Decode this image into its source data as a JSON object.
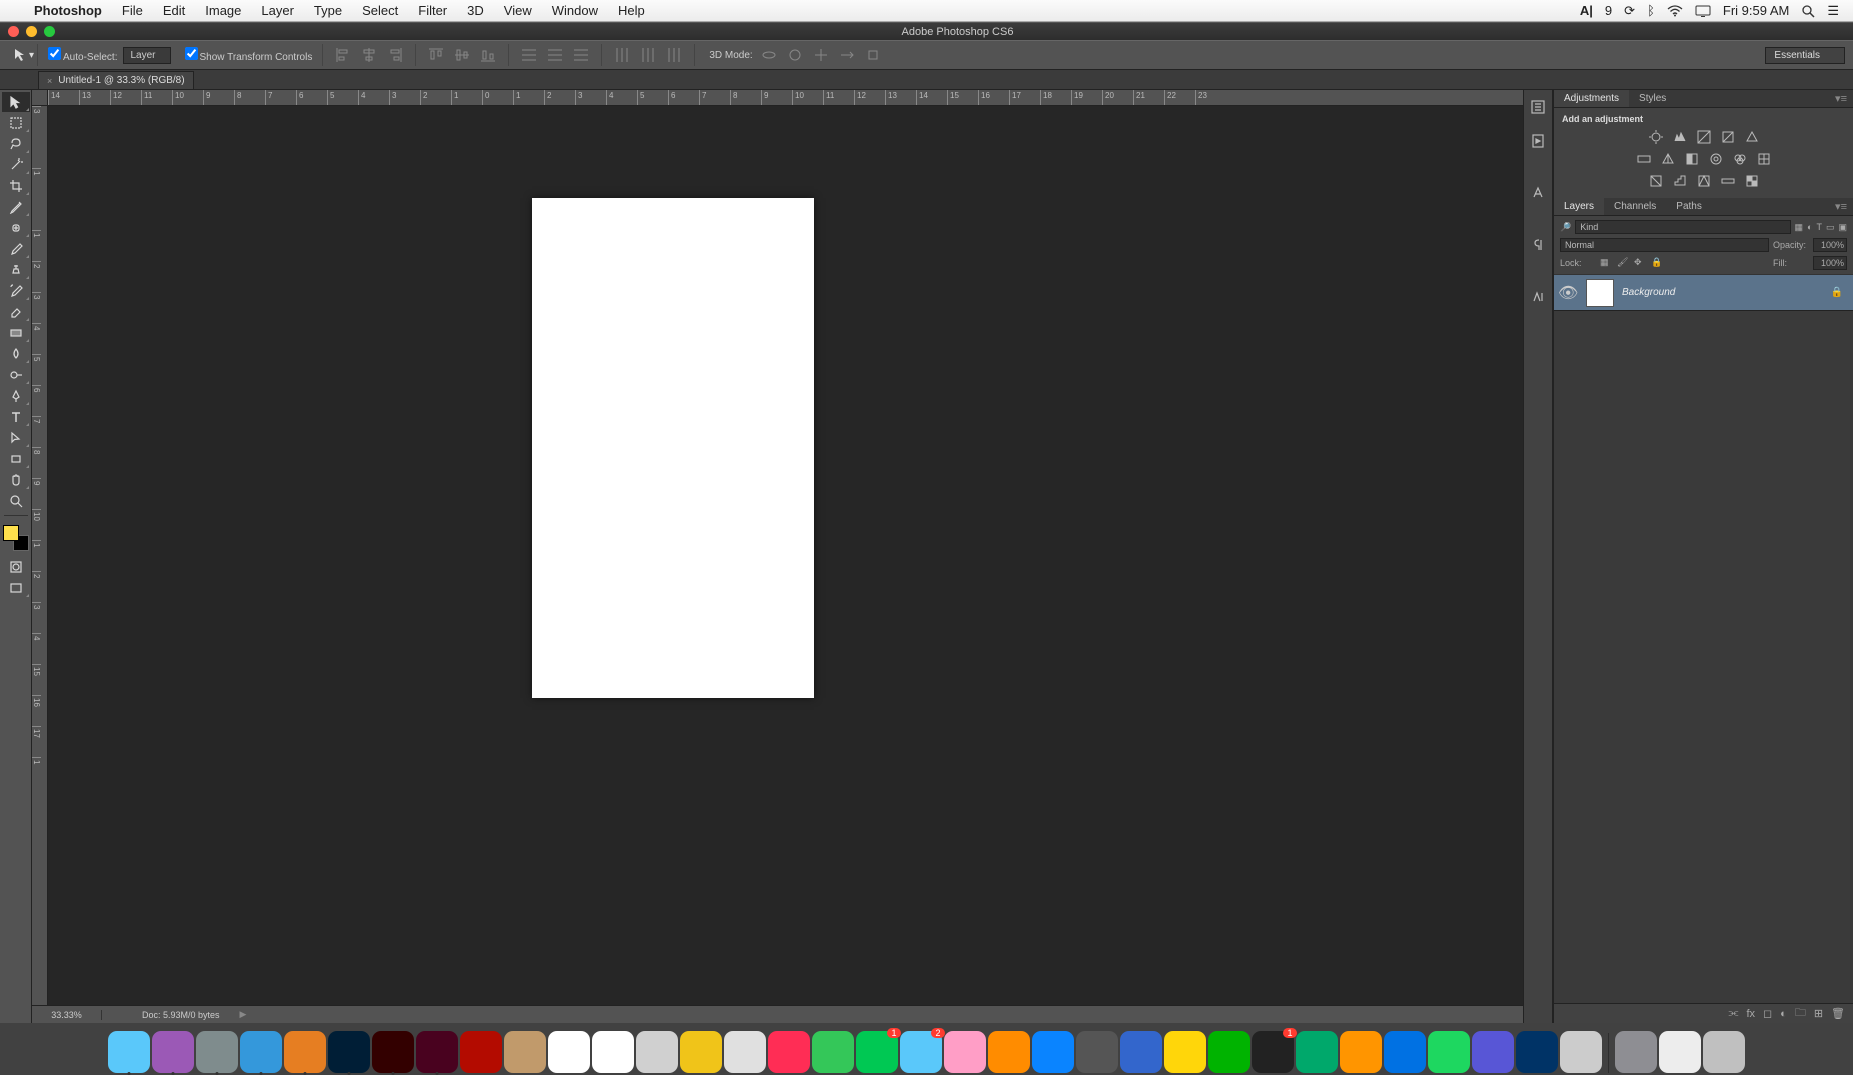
{
  "menubar": {
    "app": "Photoshop",
    "items": [
      "File",
      "Edit",
      "Image",
      "Layer",
      "Type",
      "Select",
      "Filter",
      "3D",
      "View",
      "Window",
      "Help"
    ],
    "status_left": "9",
    "clock": "Fri 9:59 AM"
  },
  "window": {
    "title": "Adobe Photoshop CS6"
  },
  "options": {
    "auto_select": "Auto-Select:",
    "auto_select_mode": "Layer",
    "show_transform": "Show Transform Controls",
    "mode3d": "3D Mode:",
    "workspace": "Essentials"
  },
  "tab": {
    "title": "Untitled-1 @ 33.3% (RGB/8)"
  },
  "ruler_h": [
    "14",
    "13",
    "12",
    "11",
    "10",
    "9",
    "8",
    "7",
    "6",
    "5",
    "4",
    "3",
    "2",
    "1",
    "0",
    "1",
    "2",
    "3",
    "4",
    "5",
    "6",
    "7",
    "8",
    "9",
    "10",
    "11",
    "12",
    "13",
    "14",
    "15",
    "16",
    "17",
    "18",
    "19",
    "20",
    "21",
    "22",
    "23"
  ],
  "ruler_v": [
    "3",
    "",
    "1",
    "",
    "1",
    "2",
    "3",
    "4",
    "5",
    "6",
    "7",
    "8",
    "9",
    "10",
    "1",
    "2",
    "3",
    "4",
    "15",
    "16",
    "17",
    "1"
  ],
  "status": {
    "zoom": "33.33%",
    "doc": "Doc: 5.93M/0 bytes"
  },
  "panels": {
    "adj_tabs": [
      "Adjustments",
      "Styles"
    ],
    "adj_title": "Add an adjustment",
    "layer_tabs": [
      "Layers",
      "Channels",
      "Paths"
    ],
    "kind": "Kind",
    "blend": "Normal",
    "opacity_label": "Opacity:",
    "opacity": "100%",
    "lock_label": "Lock:",
    "fill_label": "Fill:",
    "fill": "100%",
    "layer_name": "Background"
  },
  "dock_apps": [
    {
      "c": "#5ac8fa"
    },
    {
      "c": "#9b59b6"
    },
    {
      "c": "#7f8c8d"
    },
    {
      "c": "#3498db"
    },
    {
      "c": "#e67e22"
    },
    {
      "c": "#001e36"
    },
    {
      "c": "#330000"
    },
    {
      "c": "#49021f"
    },
    {
      "c": "#b30b00"
    },
    {
      "c": "#c19a6b"
    },
    {
      "c": "#ffffff"
    },
    {
      "c": "#ffffff"
    },
    {
      "c": "#d0d0d0"
    },
    {
      "c": "#f0c419"
    },
    {
      "c": "#e0e0e0"
    },
    {
      "c": "#ff2d55"
    },
    {
      "c": "#34c759"
    },
    {
      "c": "#00c853",
      "b": "1"
    },
    {
      "c": "#5ac8fa",
      "b": "2"
    },
    {
      "c": "#ff9ec6"
    },
    {
      "c": "#ff8c00"
    },
    {
      "c": "#0a84ff"
    },
    {
      "c": "#555555"
    },
    {
      "c": "#3366cc"
    },
    {
      "c": "#ffd60a"
    },
    {
      "c": "#00b300"
    },
    {
      "c": "#222222",
      "b": "1"
    },
    {
      "c": "#00a86b"
    },
    {
      "c": "#ff9500"
    },
    {
      "c": "#0071e3"
    },
    {
      "c": "#1ed760"
    },
    {
      "c": "#5856d6"
    },
    {
      "c": "#003366"
    },
    {
      "c": "#cccccc"
    },
    {
      "c": "#8e8e93"
    },
    {
      "c": "#ededed"
    },
    {
      "c": "#c0c0c0"
    }
  ]
}
